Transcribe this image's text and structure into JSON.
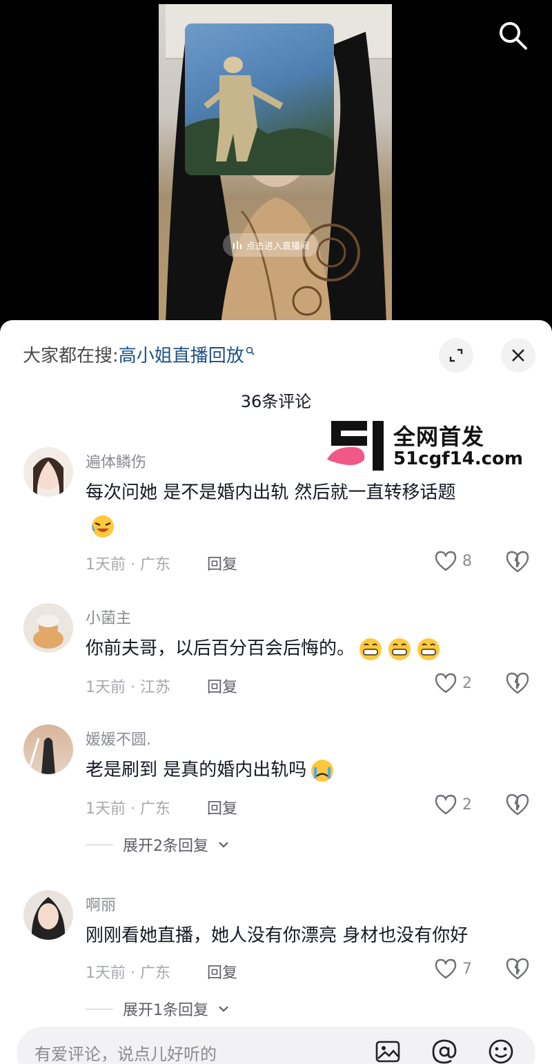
{
  "video": {
    "live_prompt": "点击进入直播间"
  },
  "sheet": {
    "trending_label": "大家都在搜:",
    "trending_query": "高小姐直播回放",
    "comment_count": "36条评论"
  },
  "watermark": {
    "logo_text": "51",
    "line1": "全网首发",
    "line2": "51cgf14.com"
  },
  "comments": [
    {
      "username": "遍体鳞伤",
      "text": "每次问她 是不是婚内出轨  然后就一直转移话题",
      "emoji": "laughing-crying-emoji",
      "time_location": "1天前 · 广东",
      "reply_label": "回复",
      "likes": "8"
    },
    {
      "username": "小菌主",
      "text": "你前夫哥，以后百分百会后悔的。",
      "emoji": "grinning-emoji x3",
      "time_location": "1天前 · 江苏",
      "reply_label": "回复",
      "likes": "2"
    },
    {
      "username": "媛媛不圆.",
      "text": "老是刷到  是真的婚内出轨吗",
      "emoji": "crying-emoji",
      "time_location": "1天前 · 广东",
      "reply_label": "回复",
      "likes": "2",
      "expand_replies": "展开2条回复"
    },
    {
      "username": "啊丽",
      "text": "刚刚看她直播，她人没有你漂亮 身材也没有你好",
      "time_location": "1天前 · 广东",
      "reply_label": "回复",
      "likes": "7",
      "expand_replies": "展开1条回复"
    }
  ],
  "input": {
    "placeholder": "有爱评论，说点儿好听的"
  },
  "colors": {
    "link": "#1c4f8c",
    "sheet_bg": "#ffffff",
    "muted": "#8a8b91",
    "watermark_pink": "#f0588a"
  }
}
